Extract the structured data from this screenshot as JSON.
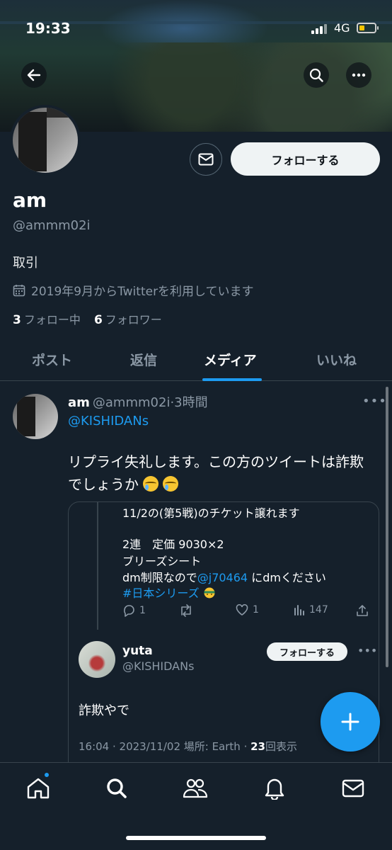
{
  "status_bar": {
    "time": "19:33",
    "network": "4G"
  },
  "profile": {
    "name": "am",
    "handle": "@ammm02i",
    "bio": "取引",
    "joined": "2019年9月からTwitterを利用しています",
    "following_count": "3",
    "following_label": "フォロー中",
    "followers_count": "6",
    "followers_label": "フォロワー",
    "follow_button": "フォローする"
  },
  "tabs": [
    {
      "label": "ポスト",
      "active": false
    },
    {
      "label": "返信",
      "active": false
    },
    {
      "label": "メディア",
      "active": true
    },
    {
      "label": "いいね",
      "active": false
    }
  ],
  "post": {
    "author_name": "am",
    "author_handle": "@ammm02i",
    "time": "·3時間",
    "mention": "@KISHIDANs",
    "text_line1": "リプライ失礼します。この方のツイートは詐欺",
    "text_line2": "でしょうか",
    "quote": {
      "line1": "11/2の(第5戦)のチケット譲れます",
      "line2": "2連　定価 9030×2",
      "line3": "ブリーズシート",
      "line4_prefix": "dm制限なので",
      "line4_link": "@j70464",
      "line4_suffix": "にdmください",
      "hashtag": "#日本シリーズ",
      "replies": "1",
      "likes": "1",
      "views": "147"
    },
    "reply": {
      "name": "yuta",
      "handle": "@KISHIDANs",
      "follow_button": "フォローする",
      "text": "詐欺やで",
      "meta": "16:04 · 2023/11/02 場所: Earth · ",
      "view_count": "23",
      "view_label": "回表示"
    }
  },
  "colors": {
    "accent": "#1d9bf0",
    "background": "#15202b",
    "muted": "#8b98a5"
  },
  "icons": [
    "back-arrow-icon",
    "search-icon",
    "more-icon",
    "mail-icon",
    "calendar-icon",
    "reply-icon",
    "retweet-icon",
    "like-icon",
    "views-icon",
    "share-icon",
    "plus-icon",
    "home-icon",
    "explore-icon",
    "communities-icon",
    "notifications-icon",
    "messages-icon"
  ]
}
